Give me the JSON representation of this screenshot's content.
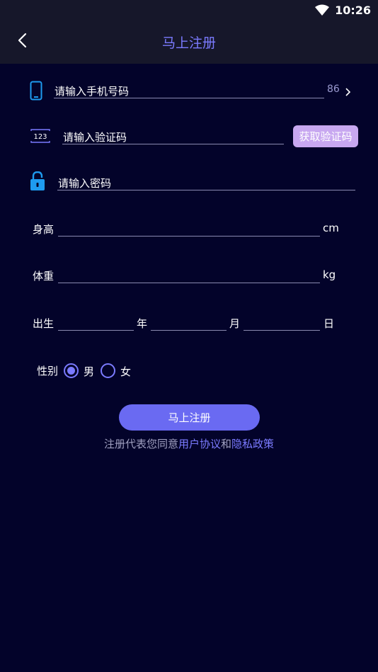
{
  "status": {
    "time": "10:26"
  },
  "header": {
    "title": "马上注册"
  },
  "form": {
    "phone": {
      "placeholder": "请输入手机号码",
      "country_code": "86"
    },
    "code": {
      "placeholder": "请输入验证码",
      "button": "获取验证码",
      "icon_text": "123"
    },
    "password": {
      "placeholder": "请输入密码"
    },
    "height": {
      "label": "身高",
      "unit": "cm"
    },
    "weight": {
      "label": "体重",
      "unit": "kg"
    },
    "birth": {
      "label": "出生",
      "year": "年",
      "month": "月",
      "day": "日"
    },
    "gender": {
      "label": "性别",
      "male": "男",
      "female": "女",
      "selected": "male"
    }
  },
  "submit": {
    "label": "马上注册"
  },
  "agreement": {
    "prefix": "注册代表您同意",
    "terms": "用户协议",
    "and": "和",
    "privacy": "隐私政策"
  },
  "colors": {
    "background": "#03032a",
    "accent": "#7b7bff",
    "code_button": "#c8a8f0",
    "submit_button": "#6a6af2",
    "icon_blue": "#1e9bf0"
  }
}
